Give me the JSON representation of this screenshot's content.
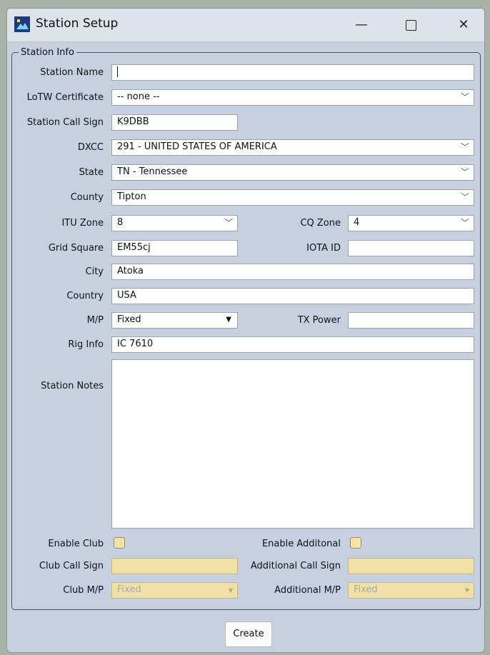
{
  "window": {
    "title": "Station Setup",
    "minimize": "—",
    "close": "✕"
  },
  "group": {
    "title": "Station Info"
  },
  "fields": {
    "station_name": {
      "label": "Station Name",
      "value": ""
    },
    "lotw_certificate": {
      "label": "LoTW Certificate",
      "value": "-- none --"
    },
    "station_call_sign": {
      "label": "Station Call Sign",
      "value": "K9DBB"
    },
    "dxcc": {
      "label": "DXCC",
      "value": "291 - UNITED STATES OF AMERICA"
    },
    "state": {
      "label": "State",
      "value": "TN - Tennessee"
    },
    "county": {
      "label": "County",
      "value": "Tipton"
    },
    "itu_zone": {
      "label": "ITU Zone",
      "value": "8"
    },
    "cq_zone": {
      "label": "CQ Zone",
      "value": "4"
    },
    "grid_square": {
      "label": "Grid Square",
      "value": "EM55cj"
    },
    "iota_id": {
      "label": "IOTA ID",
      "value": ""
    },
    "city": {
      "label": "City",
      "value": "Atoka"
    },
    "country": {
      "label": "Country",
      "value": "USA"
    },
    "mp": {
      "label": "M/P",
      "value": "Fixed"
    },
    "tx_power": {
      "label": "TX Power",
      "value": ""
    },
    "rig_info": {
      "label": "Rig Info",
      "value": "IC 7610"
    },
    "station_notes": {
      "label": "Station Notes",
      "value": ""
    },
    "enable_club": {
      "label": "Enable Club",
      "checked": false
    },
    "enable_additional": {
      "label": "Enable Additonal",
      "checked": false
    },
    "club_call_sign": {
      "label": "Club Call Sign",
      "value": ""
    },
    "additional_call_sign": {
      "label": "Additional Call Sign",
      "value": ""
    },
    "club_mp": {
      "label": "Club M/P",
      "value": "Fixed"
    },
    "additional_mp": {
      "label": "Additional M/P",
      "value": "Fixed"
    }
  },
  "buttons": {
    "create": "Create"
  },
  "icons": {
    "dropdown": "chevron-down-icon",
    "dropdown_solid": "triangle-down-icon"
  },
  "colors": {
    "window_bg": "#c7d0de",
    "disabled_field": "#f0e0a8",
    "titlebar": "#dde3ea"
  }
}
